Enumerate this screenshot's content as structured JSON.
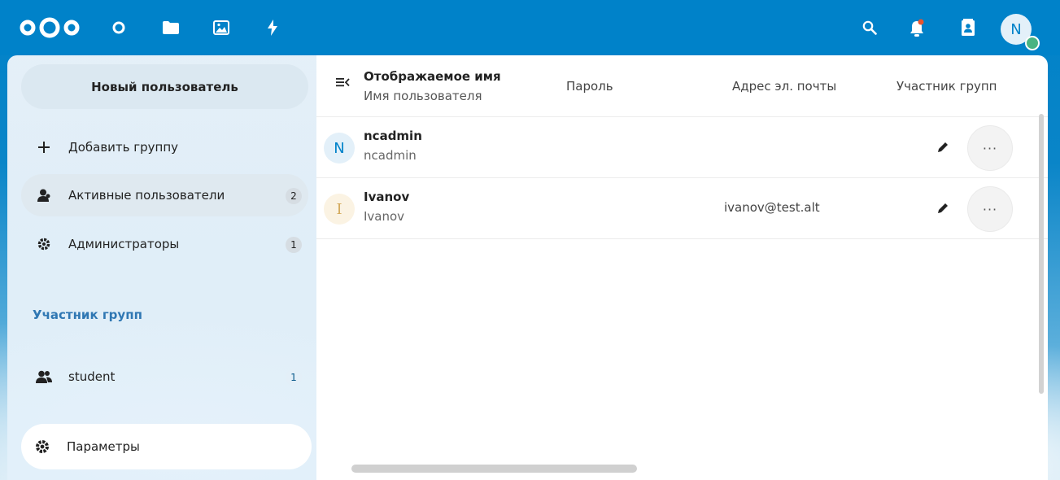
{
  "header": {
    "logo": "nextcloud-logo",
    "apps": [
      "dashboard-icon",
      "files-icon",
      "photos-icon",
      "activity-icon"
    ],
    "right_icons": [
      "search-icon",
      "notifications-icon",
      "contacts-icon"
    ],
    "avatar_letter": "N"
  },
  "sidebar": {
    "new_user_label": "Новый пользователь",
    "add_group_label": "Добавить группу",
    "items": [
      {
        "label": "Активные пользователи",
        "count": "2",
        "icon": "user-icon"
      },
      {
        "label": "Администраторы",
        "count": "1",
        "icon": "gear-icon"
      }
    ],
    "groups_caption": "Участник групп",
    "groups": [
      {
        "label": "student",
        "count": "1",
        "icon": "group-icon"
      }
    ],
    "settings_label": "Параметры"
  },
  "table": {
    "header": {
      "display_name": "Отображаемое имя",
      "username": "Имя пользователя",
      "password": "Пароль",
      "email": "Адрес эл. почты",
      "groups": "Участник групп"
    },
    "rows": [
      {
        "avatar": "N",
        "display_name": "ncadmin",
        "username": "ncadmin",
        "email": "",
        "avatar_color": "#0082c9",
        "avatar_bg": "#e3f0f9"
      },
      {
        "avatar": "I",
        "display_name": "Ivanov",
        "username": "Ivanov",
        "email": "ivanov@test.alt",
        "avatar_color": "#d3a95a",
        "avatar_bg": "#fbf3e3"
      }
    ],
    "more_label": "···"
  },
  "colors": {
    "brand": "#0082c9",
    "online": "#49b382"
  }
}
